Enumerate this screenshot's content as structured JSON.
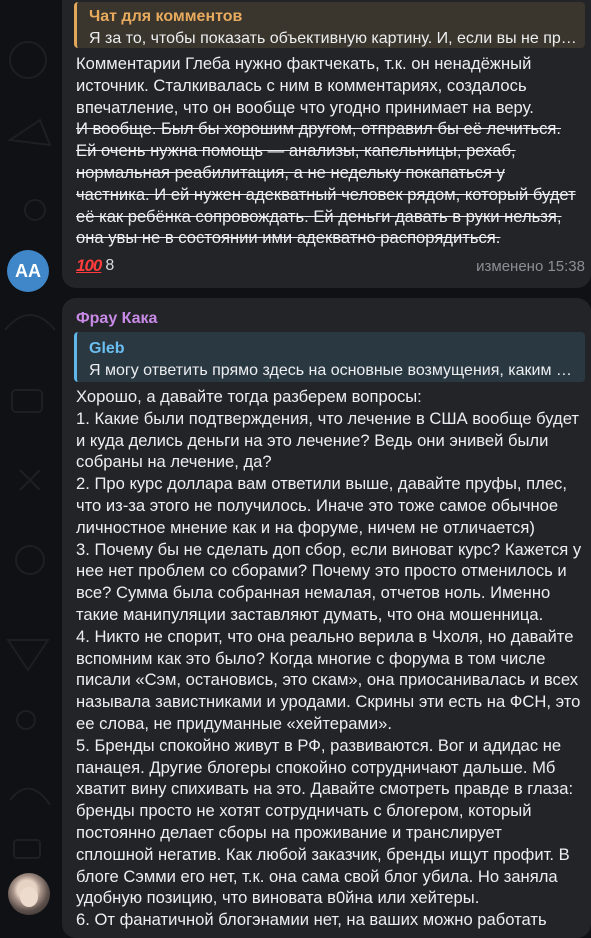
{
  "message1": {
    "reply": {
      "title": "Чат для комментов",
      "text": "Я за то, чтобы показать объективную картину. И, если вы не прочитали"
    },
    "lines": [
      {
        "t": "Комментарии Глеба нужно фактчекать, т.к. он ненадёжный",
        "s": false
      },
      {
        "t": "источник. Сталкивалась с ним в комментариях, создалось",
        "s": false
      },
      {
        "t": "впечатление, что он вообще что угодно принимает на веру.",
        "s": false
      },
      {
        "t": "И вообще. Был бы хорошим другом, отправил бы её лечиться.",
        "s": true
      },
      {
        "t": "Ей очень нужна помощь — анализы, капельницы, рехаб,",
        "s": true
      },
      {
        "t": "нормальная реабилитация, а не недельку покапаться у",
        "s": true
      },
      {
        "t": "частника. И ей нужен адекватный человек рядом, который будет",
        "s": true
      },
      {
        "t": "её как ребёнка сопровождать. Ей деньги давать в руки нельзя,",
        "s": true
      },
      {
        "t": "она увы не в состоянии ими адекватно распорядиться.",
        "s": true
      }
    ],
    "reaction": {
      "emoji": "100",
      "count": "8"
    },
    "meta": "изменено 15:38",
    "avatar_initials": "AA"
  },
  "message2": {
    "author": "Фрау Кака",
    "reply": {
      "title": "Gleb",
      "text": "Я могу ответить прямо здесь на основные возмущения, каким образом"
    },
    "lines": [
      "Хорошо, а давайте тогда разберем вопросы:",
      "1. Какие были подтверждения, что лечение в США вообще будет",
      "и куда делись деньги на это лечение? Ведь они энивей были",
      "собраны на лечение, да?",
      "2. Про курс доллара вам ответили выше, давайте пруфы, плес,",
      "что из-за этого не получилось. Иначе это тоже самое обычное",
      "личностное мнение как и на форуме, ничем не отличается)",
      "3. Почему бы не сделать доп сбор, если виноват курс? Кажется у",
      "нее нет проблем со сборами? Почему это просто отменилось и",
      "все? Сумма была собранная немалая, отчетов ноль. Именно",
      "такие манипуляции заставляют думать, что она мошенница.",
      "4. Никто не спорит, что она реально верила в Чхоля, но давайте",
      "вспомним как это было? Когда многие с форума в том числе",
      "писали «Сэм, остановись, это скам», она приосанивалась и всех",
      "называла завистниками и уродами. Скрины эти есть на ФСН, это",
      "ее слова, не придуманные «хейтерами».",
      "5. Бренды спокойно живут в РФ, развиваются. Вог и адидас не",
      "панацея. Другие блогеры спокойно сотрудничают дальше. Мб",
      "хватит вину спихивать на это. Давайте смотреть правде в глаза:",
      "бренды просто не хотят сотрудничать с блогером, который",
      "постоянно делает сборы на проживание и транслирует",
      "сплошной негатив. Как любой заказчик, бренды ищут профит. В",
      "блоге Сэмми его нет, т.к. она сама свой блог убила. Но заняла",
      "удобную позицию, что виновата в0йна или хейтеры.",
      "6. От фанатичной блогэнамии нет, на ваших можно работать"
    ]
  }
}
